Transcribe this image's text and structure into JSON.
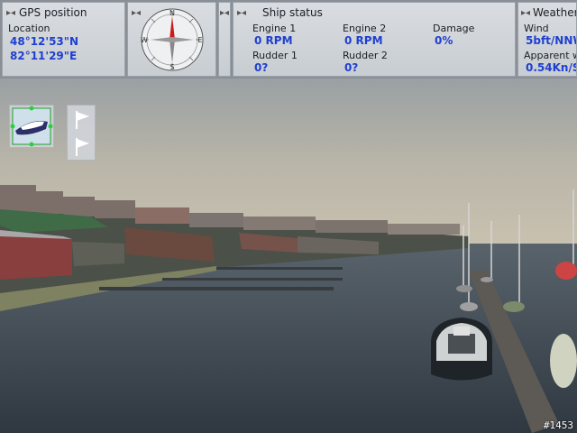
{
  "gps": {
    "title": "GPS position",
    "location_label": "Location",
    "lat": "48°12'53\"N",
    "lon": "82°11'29\"E"
  },
  "compass": {
    "n": "N",
    "e": "E",
    "s": "S",
    "w": "W"
  },
  "ship": {
    "title": "Ship status",
    "engine1_label": "Engine 1",
    "engine1_value": "0 RPM",
    "engine2_label": "Engine 2",
    "engine2_value": "0 RPM",
    "damage_label": "Damage",
    "damage_value": "0%",
    "rudder1_label": "Rudder 1",
    "rudder1_value": "0?",
    "rudder2_label": "Rudder 2",
    "rudder2_value": "0?"
  },
  "weather": {
    "title": "Weather",
    "wind_label": "Wind",
    "wind_value": "5bft/NNW",
    "apparent_label": "Apparent w",
    "apparent_value": "0.54Kn/S"
  },
  "watermark": "#1453",
  "colors": {
    "value_blue": "#1f3fd0",
    "sky": "#b7b3a6",
    "water": "#3e4850"
  }
}
